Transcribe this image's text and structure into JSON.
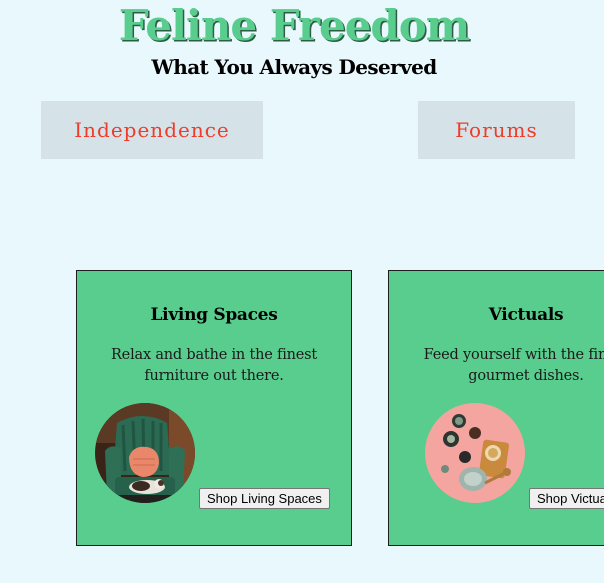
{
  "header": {
    "title": "Feline Freedom",
    "subtitle": "What You Always Deserved"
  },
  "nav": {
    "items": [
      {
        "label": "Independence"
      },
      {
        "label": "Forums"
      }
    ]
  },
  "cards": [
    {
      "title": "Living Spaces",
      "description": "Relax and bathe in the finest furniture out there.",
      "image": "cat-on-green-armchair-photo",
      "button_label": "Shop Living Spaces"
    },
    {
      "title": "Victuals",
      "description": "Feed yourself with the finest gourmet dishes.",
      "image": "gourmet-dishes-photo",
      "button_label": "Shop Victuals"
    }
  ],
  "colors": {
    "background": "#e8f8fd",
    "title_green": "#59cd8e",
    "card_green": "#59cd8e",
    "nav_bg": "#d5e3e8",
    "nav_text": "#ee3c2a"
  }
}
